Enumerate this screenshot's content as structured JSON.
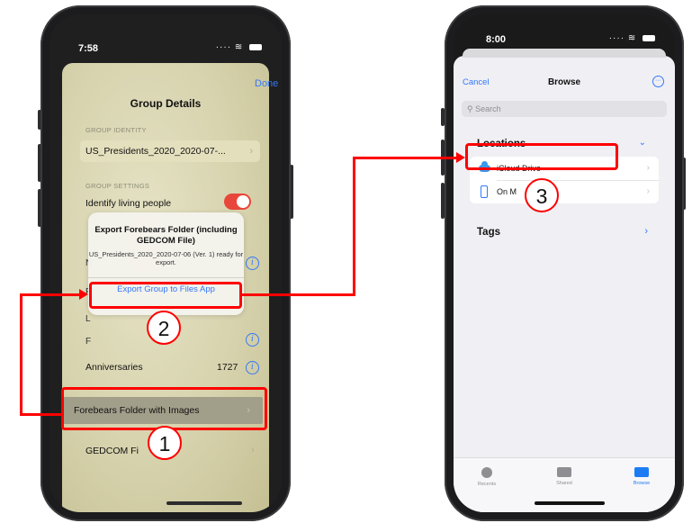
{
  "left_phone": {
    "status": {
      "time": "7:58"
    },
    "header": {
      "title": "Group Details",
      "done_label": "Done"
    },
    "group_identity": {
      "section": "GROUP IDENTITY",
      "name": "US_Presidents_2020_2020-07-..."
    },
    "group_settings": {
      "section": "GROUP SETTINGS",
      "identify_living": "Identify living people"
    },
    "anniversaries": {
      "label": "Anniversaries",
      "count": "1727"
    },
    "export_rows": {
      "folder_with_images": "Forebears Folder with Images",
      "gedcom": "GEDCOM Fi"
    },
    "alert": {
      "title": "Export Forebears Folder (including GEDCOM File)",
      "message": "US_Presidents_2020_2020-07-06 (Ver. 1) ready for export.",
      "button": "Export Group to Files App"
    }
  },
  "right_phone": {
    "status": {
      "time": "8:00"
    },
    "header": {
      "cancel_label": "Cancel",
      "title": "Browse"
    },
    "search": {
      "placeholder": "Search"
    },
    "locations": {
      "heading": "Locations",
      "items": [
        {
          "label": "iCloud Drive"
        },
        {
          "label": "On M"
        }
      ]
    },
    "tags": {
      "heading": "Tags"
    },
    "tabs": [
      {
        "label": "Recents"
      },
      {
        "label": "Shared"
      },
      {
        "label": "Browse"
      }
    ]
  },
  "annotations": {
    "step1": "1",
    "step2": "2",
    "step3": "3",
    "color": "#ff0000"
  },
  "icons": [
    "signal-icon",
    "wifi-icon",
    "battery-icon",
    "chevron-right-icon",
    "info-icon",
    "toggle",
    "search-icon",
    "more-icon",
    "icloud-icon",
    "iphone-icon",
    "chevron-down-icon",
    "clock-icon",
    "shared-folder-icon",
    "folder-icon"
  ]
}
